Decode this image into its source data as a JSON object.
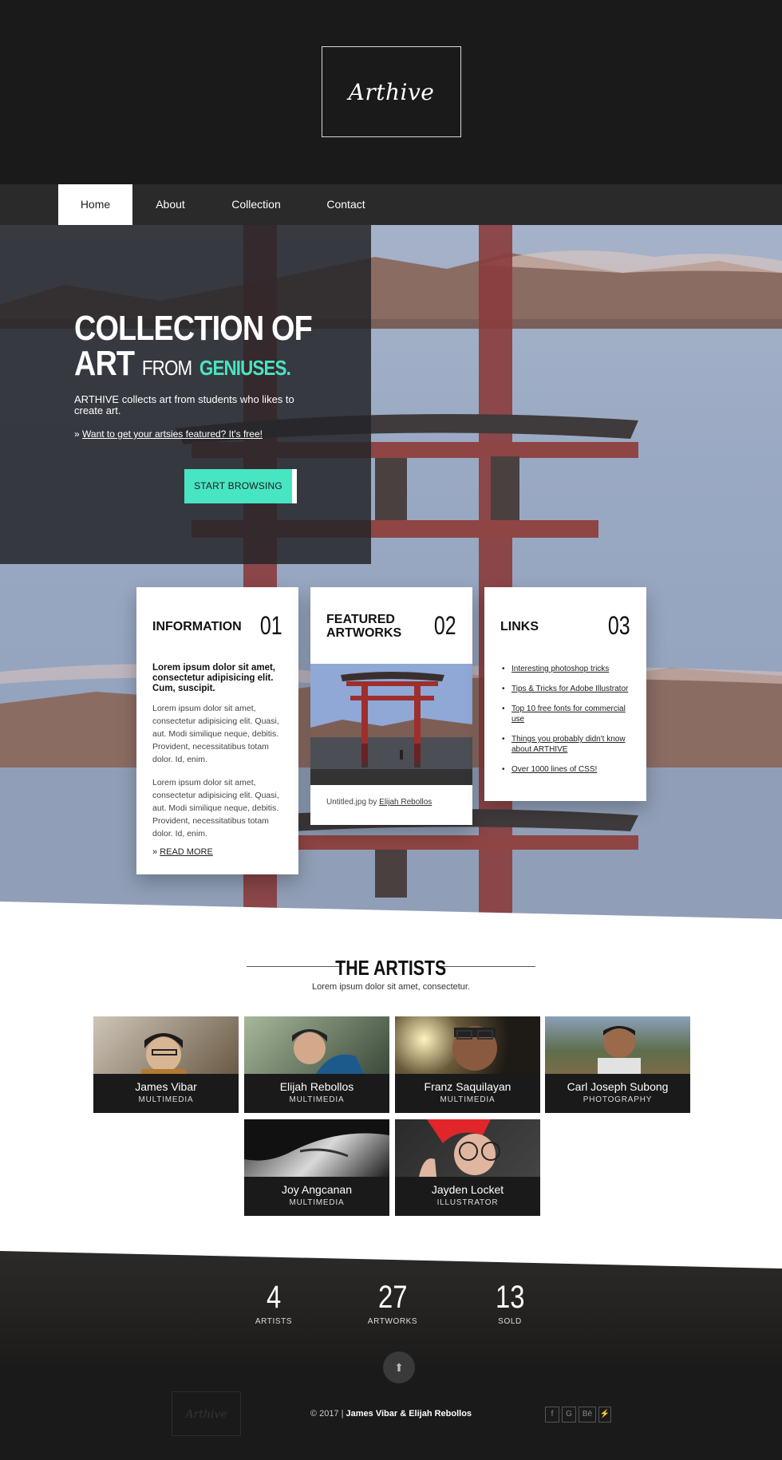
{
  "site": {
    "logo": "Arthive"
  },
  "nav": {
    "items": [
      "Home",
      "About",
      "Collection",
      "Contact"
    ],
    "active": "Home"
  },
  "hero": {
    "title_line1": "COLLECTION OF",
    "title_art": "ART",
    "title_from": "FROM",
    "title_geniuses": "GENIUSES.",
    "description": "ARTHIVE collects art from students who likes to create art.",
    "link_prefix": "»",
    "link_text": "Want to get your artsies featured? It's free!",
    "button": "START BROWSING",
    "accent_color": "#48e5c2"
  },
  "cards": {
    "info": {
      "title": "INFORMATION",
      "num": "01",
      "lead": "Lorem ipsum dolor sit amet, consectetur adipisicing elit. Cum, suscipit.",
      "p1": "Lorem ipsum dolor sit amet, consectetur adipisicing elit. Quasi, aut. Modi similique neque, debitis. Provident, necessitatibus totam dolor. Id, enim.",
      "p2": "Lorem ipsum dolor sit amet, consectetur adipisicing elit. Quasi, aut. Modi similique neque, debitis. Provident, necessitatibus totam dolor. Id, enim.",
      "read_more": "READ MORE"
    },
    "featured": {
      "title_line1": "FEATURED",
      "title_line2": "ARTWORKS",
      "num": "02",
      "caption_file": "Untitled.jpg by",
      "caption_author": "Elijah Rebollos"
    },
    "links": {
      "title": "LINKS",
      "num": "03",
      "items": [
        "Interesting photoshop tricks",
        "Tips & Tricks for Adobe Illustrator",
        "Top 10 free fonts for commercial use",
        "Things you probably didn't know about ARTHIVE",
        "Over 1000 lines of CSS!"
      ]
    }
  },
  "artists": {
    "title": "THE ARTISTS",
    "subtitle": "Lorem ipsum dolor sit amet, consectetur.",
    "list": [
      {
        "name": "James Vibar",
        "role": "MULTIMEDIA"
      },
      {
        "name": "Elijah Rebollos",
        "role": "MULTIMEDIA"
      },
      {
        "name": "Franz Saquilayan",
        "role": "MULTIMEDIA"
      },
      {
        "name": "Carl Joseph Subong",
        "role": "PHOTOGRAPHY"
      },
      {
        "name": "Joy Angcanan",
        "role": "MULTIMEDIA"
      },
      {
        "name": "Jayden Locket",
        "role": "ILLUSTRATOR"
      }
    ]
  },
  "stats": [
    {
      "num": "4",
      "label": "ARTISTS"
    },
    {
      "num": "27",
      "label": "ARTWORKS"
    },
    {
      "num": "13",
      "label": "SOLD"
    }
  ],
  "footer": {
    "logo": "Arthive",
    "copyright": "© 2017 |",
    "authors": "James Vibar & Elijah Rebollos",
    "up_icon": "arrow-up-icon",
    "social": [
      "f",
      "G",
      "Bē",
      "⚡"
    ]
  }
}
